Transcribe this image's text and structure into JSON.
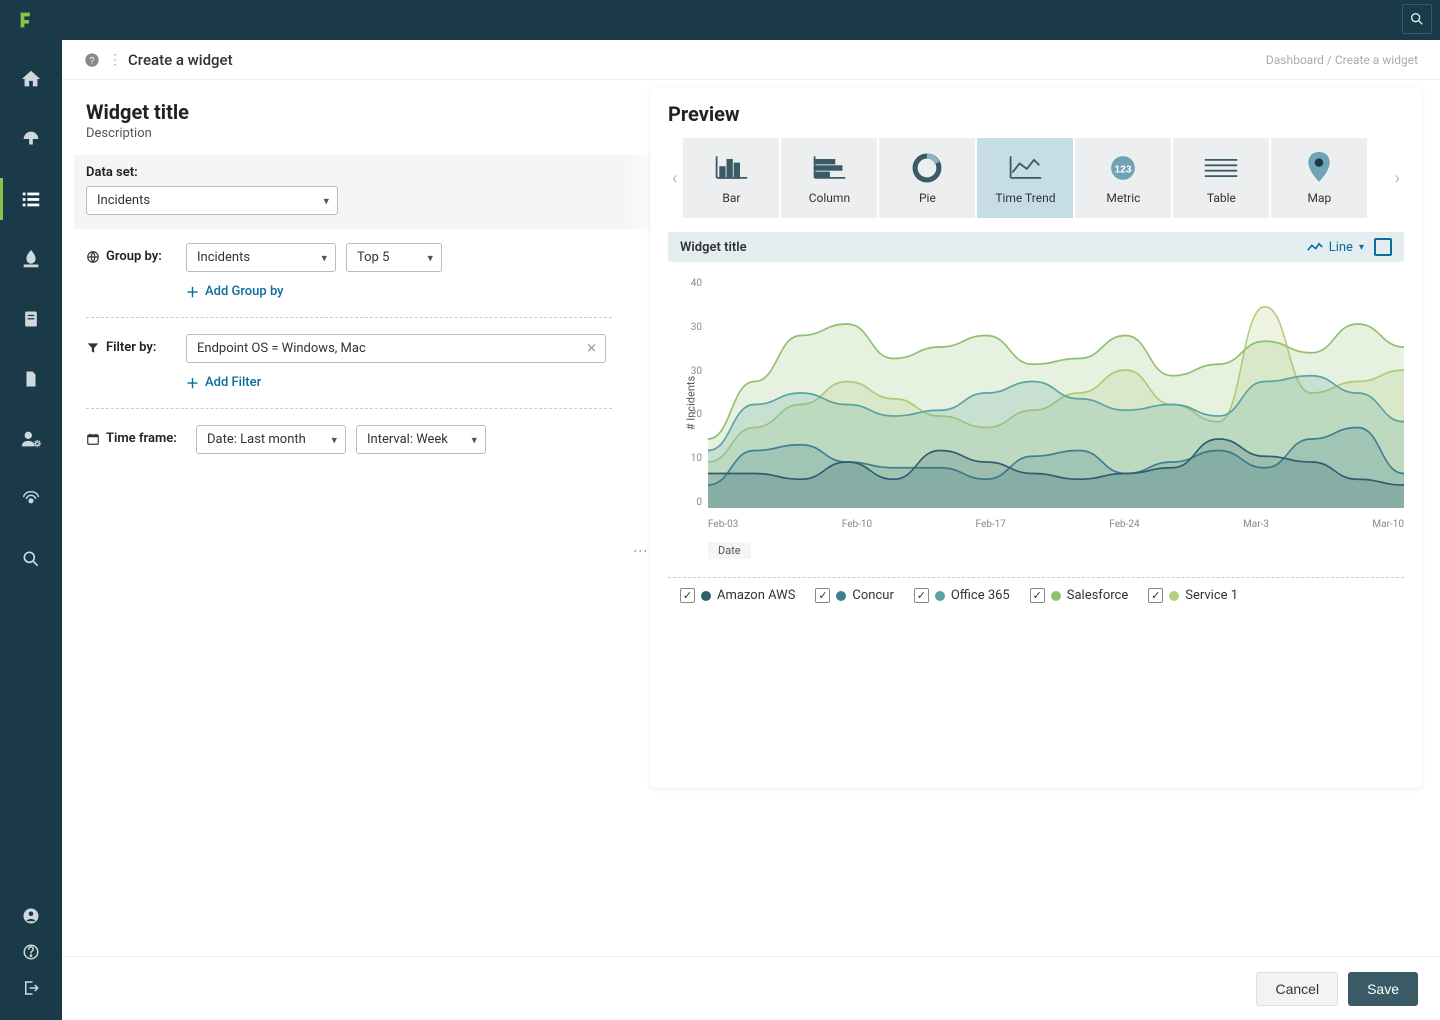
{
  "page": {
    "title": "Create a widget",
    "breadcrumb_dashboard": "Dashboard",
    "breadcrumb_sep": " / ",
    "breadcrumb_current": "Create a widget"
  },
  "config": {
    "widget_title": "Widget title",
    "description": "Description",
    "dataset_label": "Data set:",
    "dataset_value": "Incidents",
    "groupby_label": "Group by:",
    "groupby_value": "Incidents",
    "groupby_top": "Top 5",
    "add_groupby": "Add Group by",
    "filterby_label": "Filter by:",
    "filter_value": "Endpoint OS = Windows, Mac",
    "add_filter": "Add Filter",
    "timeframe_label": "Time frame:",
    "timeframe_date": "Date: Last month",
    "timeframe_interval": "Interval: Week"
  },
  "preview": {
    "heading": "Preview",
    "chart_types": {
      "bar": "Bar",
      "column": "Column",
      "pie": "Pie",
      "time_trend": "Time Trend",
      "metric": "Metric",
      "table": "Table",
      "map": "Map"
    },
    "chart_title": "Widget title",
    "line_toggle": "Line",
    "legend": {
      "amazon_aws": "Amazon AWS",
      "concur": "Concur",
      "office_365": "Office 365",
      "salesforce": "Salesforce",
      "service_1": "Service 1"
    }
  },
  "chart_data": {
    "type": "area",
    "title": "Widget title",
    "xlabel": "Date",
    "ylabel": "# Incidents",
    "ylim": [
      0,
      40
    ],
    "yticks": [
      0,
      10,
      20,
      30,
      30,
      40
    ],
    "x": [
      "Feb-03",
      "Feb-10",
      "Feb-17",
      "Feb-24",
      "Mar-3",
      "Mar-10"
    ],
    "series": [
      {
        "name": "Amazon AWS",
        "color": "#2f5f6f",
        "values": [
          6,
          6,
          5,
          8,
          5,
          10,
          8,
          6,
          5,
          6,
          7,
          12,
          9,
          8,
          5,
          4
        ]
      },
      {
        "name": "Concur",
        "color": "#3f7f8f",
        "values": [
          4,
          10,
          11,
          8,
          7,
          7,
          5,
          9,
          10,
          6,
          8,
          10,
          7,
          12,
          14,
          6
        ]
      },
      {
        "name": "Office 365",
        "color": "#5aa3a3",
        "values": [
          10,
          18,
          20,
          18,
          16,
          17,
          20,
          22,
          19,
          17,
          18,
          16,
          22,
          23,
          20,
          15
        ]
      },
      {
        "name": "Salesforce",
        "color": "#8fbf6f",
        "values": [
          12,
          22,
          30,
          32,
          26,
          28,
          30,
          25,
          26,
          30,
          23,
          25,
          29,
          27,
          32,
          28
        ]
      },
      {
        "name": "Service 1",
        "color": "#b5cf7a",
        "values": [
          8,
          14,
          18,
          22,
          19,
          16,
          14,
          17,
          20,
          24,
          18,
          15,
          35,
          20,
          22,
          24
        ]
      }
    ]
  },
  "footer": {
    "cancel": "Cancel",
    "save": "Save"
  },
  "colors": {
    "accent": "#8bc34a",
    "brand_dark": "#1a3a4a",
    "link": "#0b6e9e"
  }
}
